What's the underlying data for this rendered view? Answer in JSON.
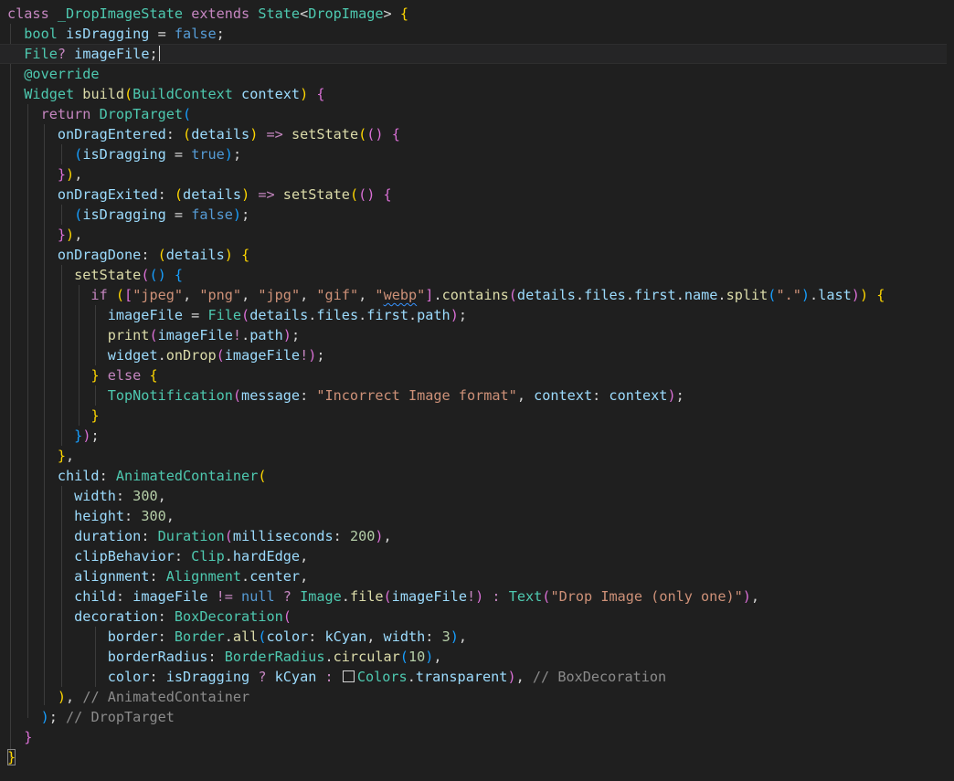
{
  "editor": {
    "lines": [
      {
        "tokens": [
          [
            "cls",
            "class "
          ],
          [
            "t",
            "_DropImageState "
          ],
          [
            "cls",
            "extends "
          ],
          [
            "t",
            "State"
          ],
          [
            "pn",
            "<"
          ],
          [
            "t",
            "DropImage"
          ],
          [
            "pn",
            "> "
          ],
          [
            "b1",
            "{"
          ]
        ]
      },
      {
        "tokens": [
          [
            "t",
            "  bool "
          ],
          [
            "v",
            "isDragging "
          ],
          [
            "pn",
            "= "
          ],
          [
            "k",
            "false"
          ],
          [
            "pn",
            ";"
          ]
        ]
      },
      {
        "tokens": [
          [
            "t",
            "  File"
          ],
          [
            "op",
            "? "
          ],
          [
            "v",
            "imageFile"
          ],
          [
            "pn",
            ";"
          ]
        ],
        "current": true,
        "cursor": true
      },
      {
        "tokens": [
          [
            "t",
            "  @override"
          ]
        ]
      },
      {
        "tokens": [
          [
            "t",
            "  Widget "
          ],
          [
            "f",
            "build"
          ],
          [
            "b1",
            "("
          ],
          [
            "t",
            "BuildContext "
          ],
          [
            "v",
            "context"
          ],
          [
            "b1",
            ") "
          ],
          [
            "b2",
            "{"
          ]
        ]
      },
      {
        "tokens": [
          [
            "kc",
            "    return "
          ],
          [
            "t",
            "DropTarget"
          ],
          [
            "b3",
            "("
          ]
        ]
      },
      {
        "tokens": [
          [
            "v",
            "      onDragEntered"
          ],
          [
            "pn",
            ": "
          ],
          [
            "b1",
            "("
          ],
          [
            "v",
            "details"
          ],
          [
            "b1",
            ") "
          ],
          [
            "op",
            "=> "
          ],
          [
            "f",
            "setState"
          ],
          [
            "b1",
            "("
          ],
          [
            "b2",
            "() "
          ],
          [
            "b2",
            "{"
          ]
        ]
      },
      {
        "tokens": [
          [
            "pn",
            "        "
          ],
          [
            "b3",
            "("
          ],
          [
            "v",
            "isDragging "
          ],
          [
            "pn",
            "= "
          ],
          [
            "k",
            "true"
          ],
          [
            "b3",
            ")"
          ],
          [
            "pn",
            ";"
          ]
        ]
      },
      {
        "tokens": [
          [
            "pn",
            "      "
          ],
          [
            "b2",
            "}"
          ],
          [
            "b1",
            ")"
          ],
          [
            "pn",
            ","
          ]
        ]
      },
      {
        "tokens": [
          [
            "v",
            "      onDragExited"
          ],
          [
            "pn",
            ": "
          ],
          [
            "b1",
            "("
          ],
          [
            "v",
            "details"
          ],
          [
            "b1",
            ") "
          ],
          [
            "op",
            "=> "
          ],
          [
            "f",
            "setState"
          ],
          [
            "b1",
            "("
          ],
          [
            "b2",
            "() "
          ],
          [
            "b2",
            "{"
          ]
        ]
      },
      {
        "tokens": [
          [
            "pn",
            "        "
          ],
          [
            "b3",
            "("
          ],
          [
            "v",
            "isDragging "
          ],
          [
            "pn",
            "= "
          ],
          [
            "k",
            "false"
          ],
          [
            "b3",
            ")"
          ],
          [
            "pn",
            ";"
          ]
        ]
      },
      {
        "tokens": [
          [
            "pn",
            "      "
          ],
          [
            "b2",
            "}"
          ],
          [
            "b1",
            ")"
          ],
          [
            "pn",
            ","
          ]
        ]
      },
      {
        "tokens": [
          [
            "v",
            "      onDragDone"
          ],
          [
            "pn",
            ": "
          ],
          [
            "b1",
            "("
          ],
          [
            "v",
            "details"
          ],
          [
            "b1",
            ") "
          ],
          [
            "b1",
            "{"
          ]
        ]
      },
      {
        "tokens": [
          [
            "f",
            "        setState"
          ],
          [
            "b2",
            "("
          ],
          [
            "b3",
            "() "
          ],
          [
            "b3",
            "{"
          ]
        ]
      },
      {
        "tokens": [
          [
            "kc",
            "          if "
          ],
          [
            "b1",
            "("
          ],
          [
            "b2",
            "["
          ],
          [
            "s",
            "\"jpeg\""
          ],
          [
            "pn",
            ", "
          ],
          [
            "s",
            "\"png\""
          ],
          [
            "pn",
            ", "
          ],
          [
            "s",
            "\"jpg\""
          ],
          [
            "pn",
            ", "
          ],
          [
            "s",
            "\"gif\""
          ],
          [
            "pn",
            ", "
          ],
          [
            "s",
            "\""
          ],
          [
            "squig",
            "webp"
          ],
          [
            "s",
            "\""
          ],
          [
            "b2",
            "]"
          ],
          [
            "pn",
            "."
          ],
          [
            "f",
            "contains"
          ],
          [
            "b2",
            "("
          ],
          [
            "v",
            "details"
          ],
          [
            "pn",
            "."
          ],
          [
            "v",
            "files"
          ],
          [
            "pn",
            "."
          ],
          [
            "v",
            "first"
          ],
          [
            "pn",
            "."
          ],
          [
            "v",
            "name"
          ],
          [
            "pn",
            "."
          ],
          [
            "f",
            "split"
          ],
          [
            "b3",
            "("
          ],
          [
            "s",
            "\".\""
          ],
          [
            "b3",
            ")"
          ],
          [
            "pn",
            "."
          ],
          [
            "v",
            "last"
          ],
          [
            "b2",
            ")"
          ],
          [
            "b1",
            ") "
          ],
          [
            "b1",
            "{"
          ]
        ]
      },
      {
        "tokens": [
          [
            "v",
            "            imageFile "
          ],
          [
            "pn",
            "= "
          ],
          [
            "t",
            "File"
          ],
          [
            "b2",
            "("
          ],
          [
            "v",
            "details"
          ],
          [
            "pn",
            "."
          ],
          [
            "v",
            "files"
          ],
          [
            "pn",
            "."
          ],
          [
            "v",
            "first"
          ],
          [
            "pn",
            "."
          ],
          [
            "v",
            "path"
          ],
          [
            "b2",
            ")"
          ],
          [
            "pn",
            ";"
          ]
        ]
      },
      {
        "tokens": [
          [
            "f",
            "            print"
          ],
          [
            "b2",
            "("
          ],
          [
            "v",
            "imageFile"
          ],
          [
            "op",
            "!"
          ],
          [
            "pn",
            "."
          ],
          [
            "v",
            "path"
          ],
          [
            "b2",
            ")"
          ],
          [
            "pn",
            ";"
          ]
        ]
      },
      {
        "tokens": [
          [
            "v",
            "            widget"
          ],
          [
            "pn",
            "."
          ],
          [
            "f",
            "onDrop"
          ],
          [
            "b2",
            "("
          ],
          [
            "v",
            "imageFile"
          ],
          [
            "op",
            "!"
          ],
          [
            "b2",
            ")"
          ],
          [
            "pn",
            ";"
          ]
        ]
      },
      {
        "tokens": [
          [
            "pn",
            "          "
          ],
          [
            "b1",
            "} "
          ],
          [
            "kc",
            "else "
          ],
          [
            "b1",
            "{"
          ]
        ]
      },
      {
        "tokens": [
          [
            "t",
            "            TopNotification"
          ],
          [
            "b2",
            "("
          ],
          [
            "v",
            "message"
          ],
          [
            "pn",
            ": "
          ],
          [
            "s",
            "\"Incorrect Image format\""
          ],
          [
            "pn",
            ", "
          ],
          [
            "v",
            "context"
          ],
          [
            "pn",
            ": "
          ],
          [
            "v",
            "context"
          ],
          [
            "b2",
            ")"
          ],
          [
            "pn",
            ";"
          ]
        ]
      },
      {
        "tokens": [
          [
            "pn",
            "          "
          ],
          [
            "b1",
            "}"
          ]
        ]
      },
      {
        "tokens": [
          [
            "pn",
            "        "
          ],
          [
            "b3",
            "}"
          ],
          [
            "b2",
            ")"
          ],
          [
            "pn",
            ";"
          ]
        ]
      },
      {
        "tokens": [
          [
            "pn",
            "      "
          ],
          [
            "b1",
            "}"
          ],
          [
            "pn",
            ","
          ]
        ]
      },
      {
        "tokens": [
          [
            "v",
            "      child"
          ],
          [
            "pn",
            ": "
          ],
          [
            "t",
            "AnimatedContainer"
          ],
          [
            "b1",
            "("
          ]
        ]
      },
      {
        "tokens": [
          [
            "v",
            "        width"
          ],
          [
            "pn",
            ": "
          ],
          [
            "n",
            "300"
          ],
          [
            "pn",
            ","
          ]
        ]
      },
      {
        "tokens": [
          [
            "v",
            "        height"
          ],
          [
            "pn",
            ": "
          ],
          [
            "n",
            "300"
          ],
          [
            "pn",
            ","
          ]
        ]
      },
      {
        "tokens": [
          [
            "v",
            "        duration"
          ],
          [
            "pn",
            ": "
          ],
          [
            "t",
            "Duration"
          ],
          [
            "b2",
            "("
          ],
          [
            "v",
            "milliseconds"
          ],
          [
            "pn",
            ": "
          ],
          [
            "n",
            "200"
          ],
          [
            "b2",
            ")"
          ],
          [
            "pn",
            ","
          ]
        ]
      },
      {
        "tokens": [
          [
            "v",
            "        clipBehavior"
          ],
          [
            "pn",
            ": "
          ],
          [
            "t",
            "Clip"
          ],
          [
            "pn",
            "."
          ],
          [
            "v",
            "hardEdge"
          ],
          [
            "pn",
            ","
          ]
        ]
      },
      {
        "tokens": [
          [
            "v",
            "        alignment"
          ],
          [
            "pn",
            ": "
          ],
          [
            "t",
            "Alignment"
          ],
          [
            "pn",
            "."
          ],
          [
            "v",
            "center"
          ],
          [
            "pn",
            ","
          ]
        ]
      },
      {
        "tokens": [
          [
            "v",
            "        child"
          ],
          [
            "pn",
            ": "
          ],
          [
            "v",
            "imageFile "
          ],
          [
            "op",
            "!= "
          ],
          [
            "k",
            "null "
          ],
          [
            "op",
            "? "
          ],
          [
            "t",
            "Image"
          ],
          [
            "pn",
            "."
          ],
          [
            "f",
            "file"
          ],
          [
            "b2",
            "("
          ],
          [
            "v",
            "imageFile"
          ],
          [
            "op",
            "!"
          ],
          [
            "b2",
            ") "
          ],
          [
            "op",
            ": "
          ],
          [
            "t",
            "Text"
          ],
          [
            "b2",
            "("
          ],
          [
            "s",
            "\"Drop Image (only one)\""
          ],
          [
            "b2",
            ")"
          ],
          [
            "pn",
            ","
          ]
        ]
      },
      {
        "tokens": [
          [
            "v",
            "        decoration"
          ],
          [
            "pn",
            ": "
          ],
          [
            "t",
            "BoxDecoration"
          ],
          [
            "b2",
            "("
          ]
        ]
      },
      {
        "tokens": [
          [
            "v",
            "            border"
          ],
          [
            "pn",
            ": "
          ],
          [
            "t",
            "Border"
          ],
          [
            "pn",
            "."
          ],
          [
            "f",
            "all"
          ],
          [
            "b3",
            "("
          ],
          [
            "v",
            "color"
          ],
          [
            "pn",
            ": "
          ],
          [
            "v",
            "kCyan"
          ],
          [
            "pn",
            ", "
          ],
          [
            "v",
            "width"
          ],
          [
            "pn",
            ": "
          ],
          [
            "n",
            "3"
          ],
          [
            "b3",
            ")"
          ],
          [
            "pn",
            ","
          ]
        ]
      },
      {
        "tokens": [
          [
            "v",
            "            borderRadius"
          ],
          [
            "pn",
            ": "
          ],
          [
            "t",
            "BorderRadius"
          ],
          [
            "pn",
            "."
          ],
          [
            "f",
            "circular"
          ],
          [
            "b3",
            "("
          ],
          [
            "n",
            "10"
          ],
          [
            "b3",
            ")"
          ],
          [
            "pn",
            ","
          ]
        ]
      },
      {
        "tokens": [
          [
            "v",
            "            color"
          ],
          [
            "pn",
            ": "
          ],
          [
            "v",
            "isDragging "
          ],
          [
            "op",
            "? "
          ],
          [
            "v",
            "kCyan "
          ],
          [
            "op",
            ": "
          ],
          [
            "swatch",
            ""
          ],
          [
            "t",
            "Colors"
          ],
          [
            "pn",
            "."
          ],
          [
            "v",
            "transparent"
          ],
          [
            "b2",
            ")"
          ],
          [
            "pn",
            ", "
          ],
          [
            "cm",
            "// BoxDecoration"
          ]
        ]
      },
      {
        "tokens": [
          [
            "pn",
            "      "
          ],
          [
            "b1",
            ")"
          ],
          [
            "pn",
            ", "
          ],
          [
            "cm",
            "// AnimatedContainer"
          ]
        ]
      },
      {
        "tokens": [
          [
            "pn",
            "    "
          ],
          [
            "b3",
            ")"
          ],
          [
            "pn",
            "; "
          ],
          [
            "cm",
            "// DropTarget"
          ]
        ]
      },
      {
        "tokens": [
          [
            "pn",
            "  "
          ],
          [
            "b2",
            "}"
          ]
        ]
      },
      {
        "tokens": [
          [
            "b1",
            "}"
          ]
        ],
        "bracketHighlight": true
      }
    ]
  },
  "colors": {
    "background": "#1f1f1f",
    "currentLine": "#252526"
  }
}
